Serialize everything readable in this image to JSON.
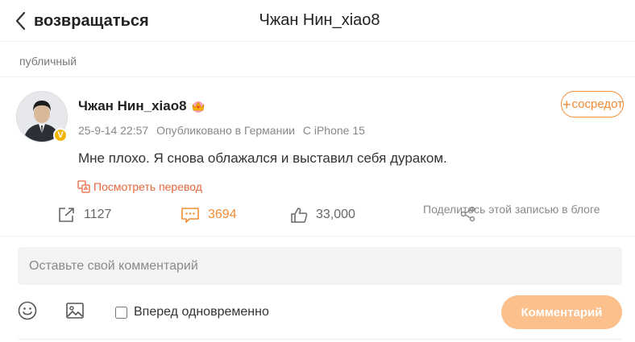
{
  "header": {
    "back_label": "возвращаться",
    "title": "Чжан Нин_xiao8"
  },
  "visibility": "публичный",
  "post": {
    "author": "Чжан Нин_xiao8",
    "follow_label": "сосредоточиться",
    "timestamp": "25-9-14 22:57",
    "location": "Опубликовано в Германии",
    "device": "С iPhone 15",
    "text": "Мне плохо. Я снова облажался и выставил себя дураком.",
    "translate_label": "Посмотреть перевод",
    "reposts": "1127",
    "comments": "3694",
    "likes": "33,000",
    "share_label": "Поделитесь этой записью в блоге"
  },
  "composer": {
    "placeholder": "Оставьте свой комментарий",
    "forward_label": "Вперед одновременно",
    "submit_label": "Комментарий"
  },
  "colors": {
    "accent": "#f18c34",
    "translate": "#e8663e",
    "submit_bg": "#fbc08c",
    "verified": "#f4b400"
  },
  "icons": [
    "chevron-left-icon",
    "crown-icon",
    "verified-icon",
    "translate-icon",
    "repost-icon",
    "comment-icon",
    "like-icon",
    "share-icon",
    "emoji-icon",
    "image-icon"
  ]
}
